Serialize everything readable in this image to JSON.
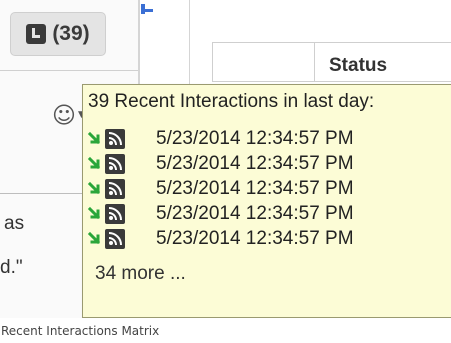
{
  "history_badge": {
    "count_label": "(39)"
  },
  "left_pane": {
    "emoji_icon_glyph": "☺",
    "caret_glyph": "▼",
    "chat_fragments": [
      "as",
      "d.\""
    ]
  },
  "table": {
    "status_header": "Status"
  },
  "tooltip": {
    "title": "39 Recent Interactions in last day:",
    "interactions": [
      {
        "time": "5/23/2014 12:34:57 PM",
        "direction_icon": "inbound-arrow-icon",
        "channel_icon": "rss-feed-icon"
      },
      {
        "time": "5/23/2014 12:34:57 PM",
        "direction_icon": "inbound-arrow-icon",
        "channel_icon": "rss-feed-icon"
      },
      {
        "time": "5/23/2014 12:34:57 PM",
        "direction_icon": "inbound-arrow-icon",
        "channel_icon": "rss-feed-icon"
      },
      {
        "time": "5/23/2014 12:34:57 PM",
        "direction_icon": "inbound-arrow-icon",
        "channel_icon": "rss-feed-icon"
      },
      {
        "time": "5/23/2014 12:34:57 PM",
        "direction_icon": "inbound-arrow-icon",
        "channel_icon": "rss-feed-icon"
      }
    ],
    "more_label": "34 more ..."
  },
  "caption": "Recent Interactions Matrix",
  "colors": {
    "tooltip_bg": "#fcfcd6",
    "arrow_green": "#2aa63a",
    "icon_dark": "#3a3a3a",
    "accent_blue": "#3b6fd4"
  }
}
